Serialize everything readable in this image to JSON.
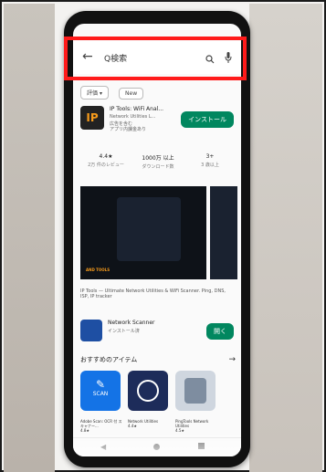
{
  "search": {
    "query": "Q検索"
  },
  "filters": [
    "評価",
    "New"
  ],
  "app": {
    "icon_text": "IP",
    "name": "IP Tools: WiFi Anal...",
    "developer": "Network Utilities L...",
    "ads": "広告を含む",
    "iap": "アプリ内課金あり",
    "install_button": "インストール"
  },
  "stats": [
    {
      "value": "4.4★",
      "label": "2万 件のレビュー"
    },
    {
      "value": "1000万 以上",
      "label": "ダウンロード数"
    },
    {
      "value": "3+",
      "label": "3 歳以上"
    }
  ],
  "screenshot": {
    "tag_text": "AND TOOLS"
  },
  "description": "IP Tools — Ultimate Network Utilities & WiFi Scanner. Ping, DNS, ISP, IP tracker",
  "scanner": {
    "name": "Network Scanner",
    "status": "インストール済",
    "open_button": "開く"
  },
  "recommended": {
    "title": "おすすめのアイテム",
    "items": [
      {
        "name": "Adobe Scan: OCR 付 スキャナー...",
        "rating": "4.8★",
        "icon": "scan-icon",
        "tile_text": "SCAN"
      },
      {
        "name": "Network Utilities",
        "rating": "4.4★",
        "icon": "globe-wrench-icon"
      },
      {
        "name": "PingTools Network Utilities",
        "rating": "4.5★",
        "icon": "server-icon"
      }
    ]
  },
  "colors": {
    "accent_green": "#01875f",
    "highlight_red": "#ff1b1b"
  }
}
